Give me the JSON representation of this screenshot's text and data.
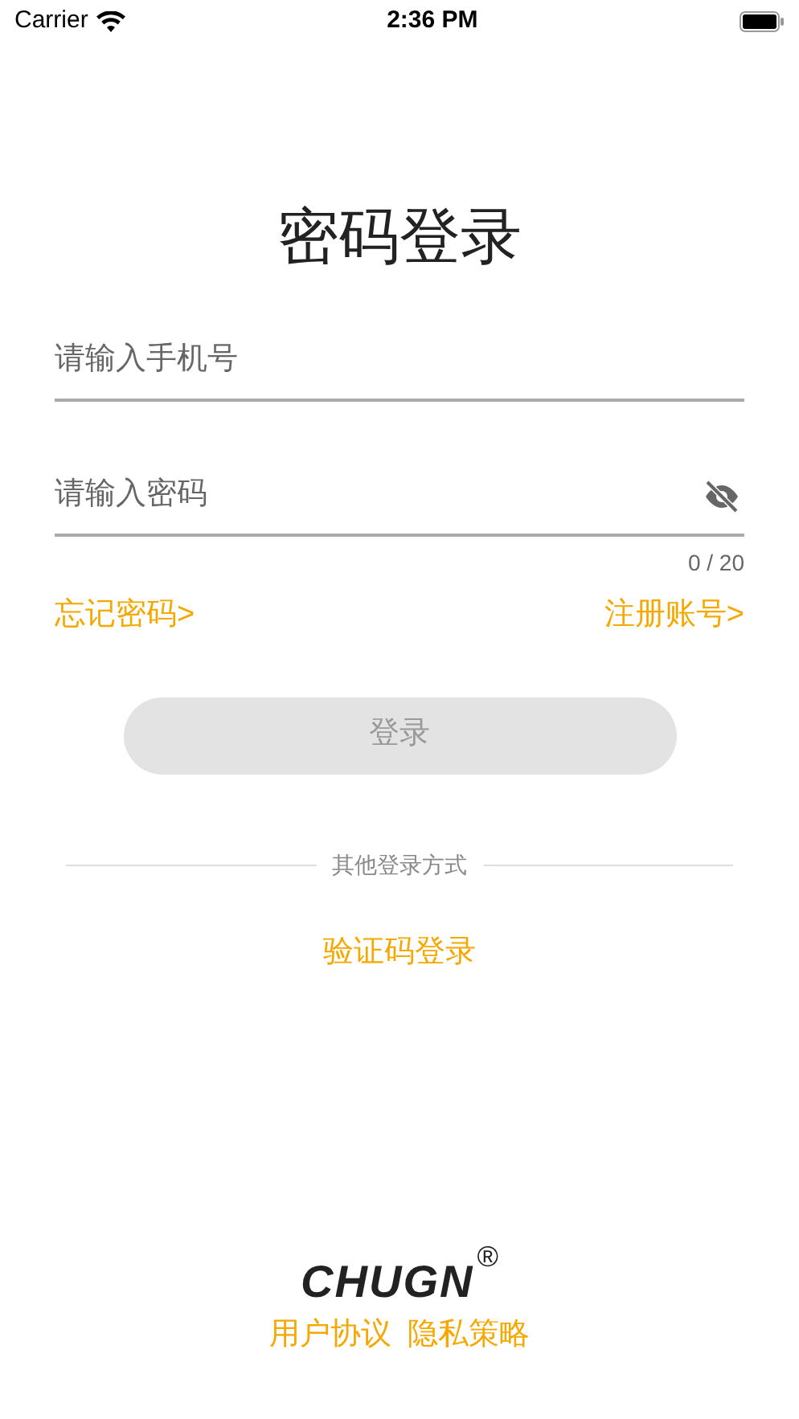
{
  "status_bar": {
    "carrier": "Carrier",
    "time": "2:36 PM"
  },
  "title": "密码登录",
  "phone_field": {
    "placeholder": "请输入手机号"
  },
  "password_field": {
    "placeholder": "请输入密码",
    "password_visible": false,
    "counter": "0 / 20"
  },
  "links": [
    "忘记密码>",
    "注册账号>"
  ],
  "login_button": {
    "label": "登录",
    "disabled": true
  },
  "divider_text": "其他登录方式",
  "sms_login": "验证码登录",
  "logo": {
    "text": "CHUGN",
    "mark": "®"
  },
  "footer_links": [
    "用户协议",
    "隐私策略"
  ]
}
